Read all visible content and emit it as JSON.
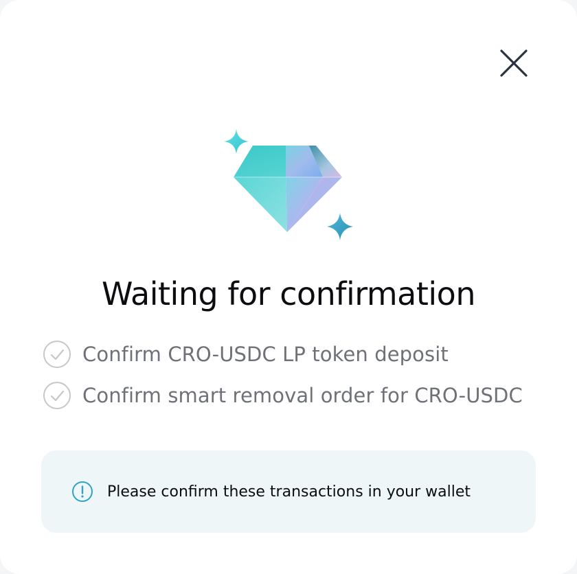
{
  "dialog": {
    "title": "Waiting for confirmation",
    "close_icon": "close-icon",
    "hero_icon": "diamond-icon"
  },
  "steps": [
    {
      "label": "Confirm CRO-USDC LP token deposit",
      "icon": "check-circle-icon",
      "completed": false
    },
    {
      "label": "Confirm smart removal order for CRO-USDC",
      "icon": "check-circle-icon",
      "completed": false
    }
  ],
  "notice": {
    "icon": "info-icon",
    "text": "Please confirm these transactions in your wallet"
  },
  "colors": {
    "accent": "#2fa3c7",
    "title": "#0c0d10",
    "muted": "#6e7178",
    "notice_bg": "#eff6f8"
  }
}
